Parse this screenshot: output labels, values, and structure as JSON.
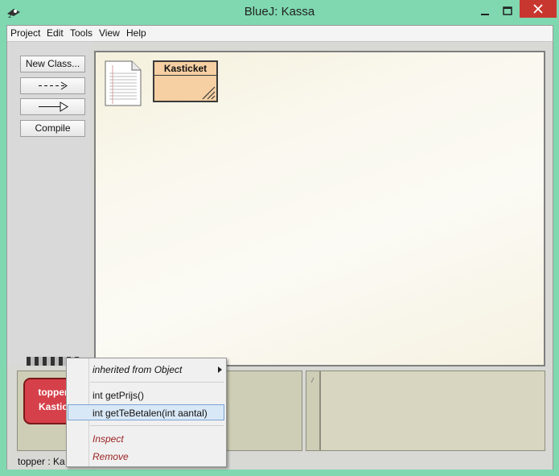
{
  "window": {
    "title": "BlueJ:  Kassa"
  },
  "menubar": {
    "items": [
      "Project",
      "Edit",
      "Tools",
      "View",
      "Help"
    ]
  },
  "toolbar": {
    "new_class_label": "New Class...",
    "compile_label": "Compile"
  },
  "diagram": {
    "class_name": "Kasticket"
  },
  "object_bench": {
    "object_line1": "topper",
    "object_line2": "Kastic"
  },
  "status": {
    "text": "topper : Ka"
  },
  "popup": {
    "inherited": "inherited from Object",
    "method1": "int getPrijs()",
    "method2": "int getTeBetalen(int aantal)",
    "inspect": "Inspect",
    "remove": "Remove"
  }
}
